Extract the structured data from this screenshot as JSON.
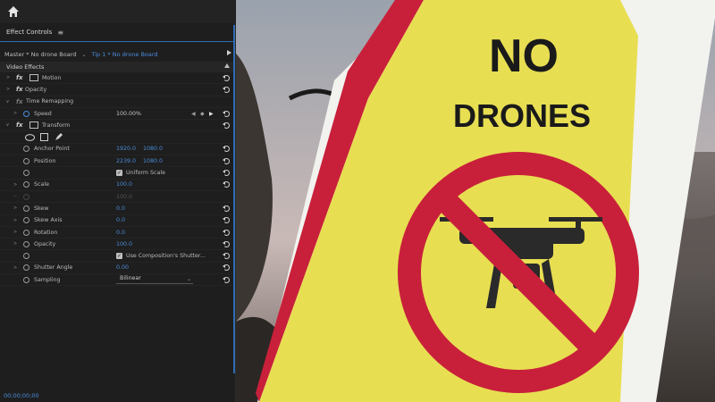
{
  "panel": {
    "title": "Effect Controls",
    "menu_icon": "≡",
    "master_label": "Master * No drone Board",
    "clip_label": "Tip 1 * No drone Board",
    "video_effects_label": "Video Effects",
    "timecode": "00;00;00;00"
  },
  "effects": {
    "motion": "Motion",
    "opacity": "Opacity",
    "time_remapping": "Time Remapping",
    "speed_label": "Speed",
    "speed_value": "100.00%",
    "transform": "Transform"
  },
  "transform": {
    "anchor_point_label": "Anchor Point",
    "anchor_x": "1920.0",
    "anchor_y": "1080.0",
    "position_label": "Position",
    "position_x": "2239.0",
    "position_y": "1080.0",
    "uniform_scale_label": "Uniform Scale",
    "scale_label": "Scale",
    "scale_value": "100.0",
    "scale_width_value": "100.0",
    "skew_label": "Skew",
    "skew_value": "0.0",
    "skew_axis_label": "Skew Axis",
    "skew_axis_value": "0.0",
    "rotation_label": "Rotation",
    "rotation_value": "0.0",
    "opacity_label": "Opacity",
    "opacity_value": "100.0",
    "use_comp_shutter_label": "Use Composition's Shutter...",
    "shutter_angle_label": "Shutter Angle",
    "shutter_angle_value": "0.00",
    "sampling_label": "Sampling",
    "sampling_value": "Bilinear"
  },
  "sign": {
    "line1": "NO",
    "line2": "DRONES"
  },
  "colors": {
    "accent_blue": "#4a8ddb",
    "sign_yellow": "#e6d94a",
    "sign_red": "#c8203a"
  }
}
